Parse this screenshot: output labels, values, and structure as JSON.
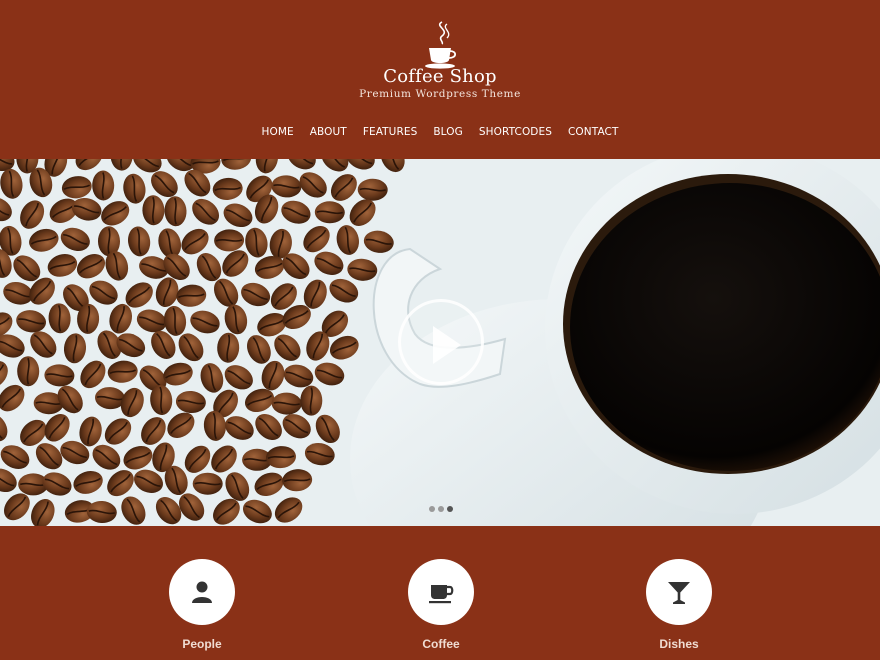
{
  "brand": {
    "title": "Coffee Shop",
    "tagline": "Premium Wordpress Theme",
    "logo_icon": "coffee-cup-icon"
  },
  "nav": {
    "items": [
      {
        "label": "HOME"
      },
      {
        "label": "ABOUT"
      },
      {
        "label": "FEATURES"
      },
      {
        "label": "BLOG"
      },
      {
        "label": "SHORTCODES"
      },
      {
        "label": "CONTACT"
      }
    ]
  },
  "slider": {
    "image": "coffee beans and cup of black coffee",
    "play_icon": "play-icon",
    "slide_count": 3,
    "active_slide": 3
  },
  "features": [
    {
      "label": "People",
      "icon": "person-icon"
    },
    {
      "label": "Coffee",
      "icon": "coffee-cup-icon"
    },
    {
      "label": "Dishes",
      "icon": "cocktail-glass-icon"
    }
  ],
  "colors": {
    "brand_brown": "#8a3117",
    "white": "#ffffff",
    "icon_dark": "#333333"
  }
}
